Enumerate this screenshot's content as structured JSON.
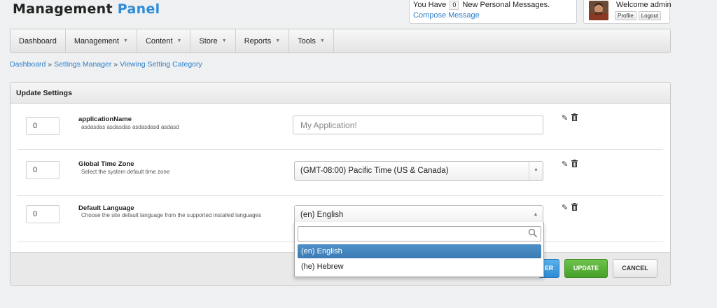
{
  "brand": {
    "part1": "Management ",
    "part2": "Panel",
    "accent": "#2e8bd6"
  },
  "messages": {
    "prefix": "You Have",
    "count": "0",
    "suffix": "New Personal Messages.",
    "compose": "Compose Message"
  },
  "user": {
    "welcome": "Welcome admin",
    "profile": "Profile",
    "logout": "Logout"
  },
  "nav": [
    {
      "label": "Dashboard",
      "dropdown": false
    },
    {
      "label": "Management",
      "dropdown": true
    },
    {
      "label": "Content",
      "dropdown": true
    },
    {
      "label": "Store",
      "dropdown": true
    },
    {
      "label": "Reports",
      "dropdown": true
    },
    {
      "label": "Tools",
      "dropdown": true
    }
  ],
  "breadcrumb": {
    "items": [
      "Dashboard",
      "Settings Manager",
      "Viewing Setting Category"
    ],
    "sep": "»"
  },
  "panel": {
    "title": "Update Settings"
  },
  "settings": [
    {
      "order": "0",
      "name": "applicationName",
      "desc": "asdasdas asdasdas asdasdasd asdasd",
      "control": "text",
      "placeholder": "My Application!"
    },
    {
      "order": "0",
      "name": "Global Time Zone",
      "desc": "Select the system default time zone",
      "control": "select",
      "value": "(GMT-08:00) Pacific Time (US & Canada)"
    },
    {
      "order": "0",
      "name": "Default Language",
      "desc": "Choose the site default language from the supported installed languages",
      "control": "select-open",
      "value": "(en) English"
    }
  ],
  "dropdown": {
    "search": "",
    "options": [
      "(en) English",
      "(he) Hebrew"
    ],
    "selected_index": 0
  },
  "buttons": {
    "partial_blue": "ER",
    "update": "UPDATE",
    "cancel": "CANCEL"
  },
  "colors": {
    "link": "#2e7fc9",
    "update_btn": "#56b036",
    "blue_btn": "#3a94dc",
    "selected_option": "#3b7cb5"
  }
}
